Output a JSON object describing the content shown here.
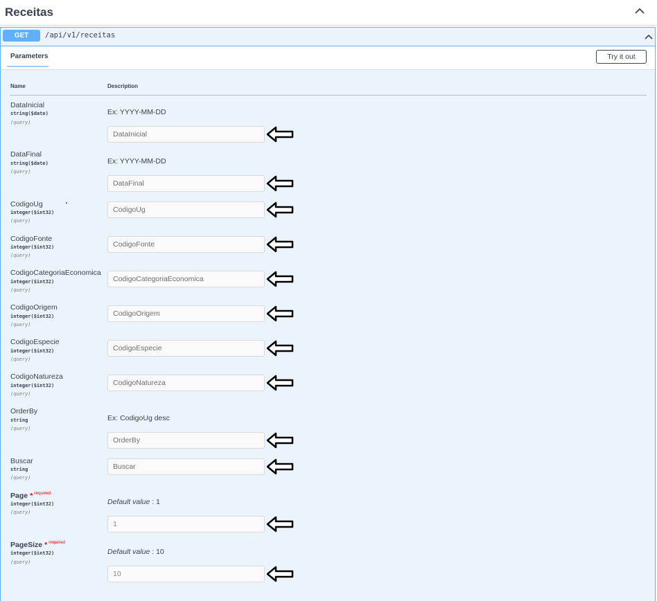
{
  "tag": {
    "title": "Receitas"
  },
  "operation": {
    "method": "GET",
    "path": "/api/v1/receitas"
  },
  "section": {
    "tab_label": "Parameters",
    "try_label": "Try it out"
  },
  "columns": {
    "name": "Name",
    "description": "Description"
  },
  "params": [
    {
      "name": "DataInicial",
      "type": "string($date)",
      "in": "(query)",
      "desc": "Ex: YYYY-MM-DD",
      "placeholder": "DataInicial"
    },
    {
      "name": "DataFinal",
      "type": "string($date)",
      "in": "(query)",
      "desc": "Ex: YYYY-MM-DD",
      "placeholder": "DataFinal"
    },
    {
      "name": "CodigoUg",
      "type": "integer($int32)",
      "in": "(query)",
      "placeholder": "CodigoUg"
    },
    {
      "name": "CodigoFonte",
      "type": "integer($int32)",
      "in": "(query)",
      "placeholder": "CodigoFonte"
    },
    {
      "name": "CodigoCategoriaEconomica",
      "type": "integer($int32)",
      "in": "(query)",
      "placeholder": "CodigoCategoriaEconomica"
    },
    {
      "name": "CodigoOrigem",
      "type": "integer($int32)",
      "in": "(query)",
      "placeholder": "CodigoOrigem"
    },
    {
      "name": "CodigoEspecie",
      "type": "integer($int32)",
      "in": "(query)",
      "placeholder": "CodigoEspecie"
    },
    {
      "name": "CodigoNatureza",
      "type": "integer($int32)",
      "in": "(query)",
      "placeholder": "CodigoNatureza"
    },
    {
      "name": "OrderBy",
      "type": "string",
      "in": "(query)",
      "desc": "Ex: CodigoUg desc",
      "placeholder": "OrderBy"
    },
    {
      "name": "Buscar",
      "type": "string",
      "in": "(query)",
      "placeholder": "Buscar"
    },
    {
      "name": "Page",
      "type": "integer($int32)",
      "in": "(query)",
      "required_star": "*",
      "required_label": "required",
      "default_label": "Default value",
      "default_sep": " : ",
      "default_value": "1",
      "value": "1"
    },
    {
      "name": "PageSize",
      "type": "integer($int32)",
      "in": "(query)",
      "required_star": "*",
      "required_label": "required",
      "default_label": "Default value",
      "default_sep": " : ",
      "default_value": "10",
      "value": "10"
    }
  ],
  "colors": {
    "get_accent": "#61affe",
    "block_bg": "#ebf3fb",
    "required": "#ff0000"
  },
  "icons": {
    "collapse": "chevron-up-icon",
    "annotation": "left-arrow-icon"
  }
}
